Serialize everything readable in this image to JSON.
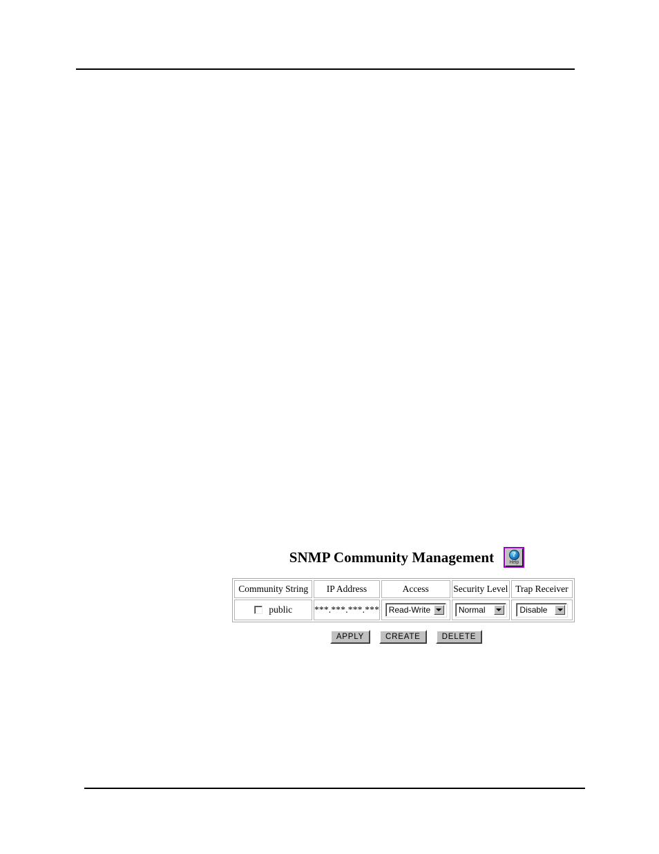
{
  "page": {
    "rule_top": true,
    "rule_bottom": true
  },
  "panel": {
    "title": "SNMP Community Management",
    "help_button": {
      "icon": "question-mark-circle-icon",
      "label": "Help",
      "border_color": "#9900cc"
    },
    "table": {
      "headers": [
        "Community String",
        "IP Address",
        "Access",
        "Security Level",
        "Trap Receiver"
      ],
      "rows": [
        {
          "community_checked": false,
          "community_string": "public",
          "ip_address": "***.***.***.***",
          "access": "Read-Write",
          "security_level": "Normal",
          "trap_receiver": "Disable"
        }
      ]
    },
    "buttons": [
      "APPLY",
      "CREATE",
      "DELETE"
    ]
  }
}
